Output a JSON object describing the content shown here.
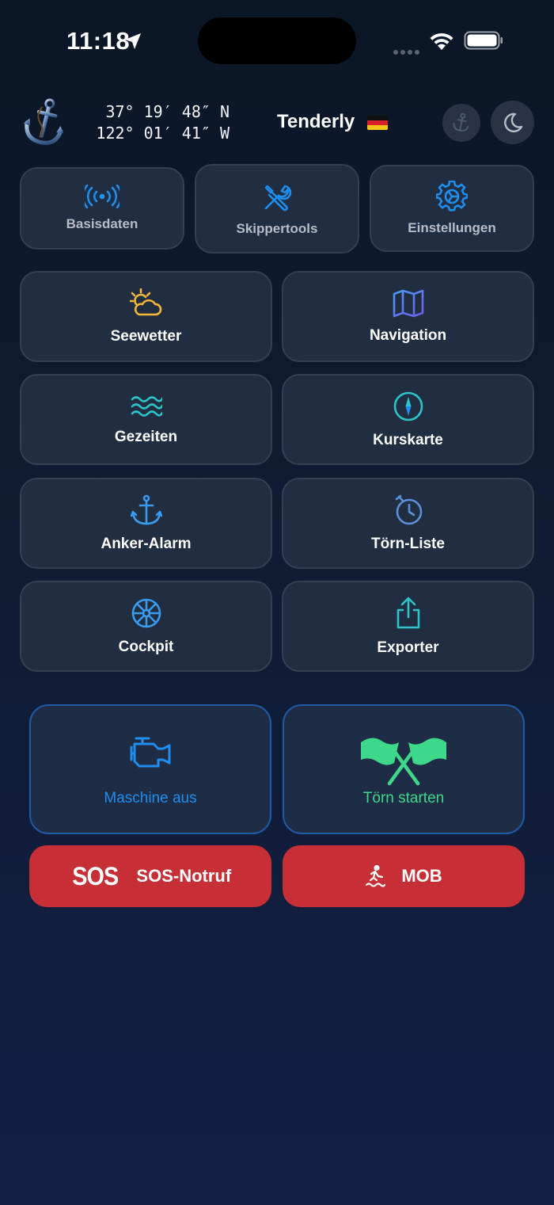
{
  "status_bar": {
    "time": "11:18"
  },
  "header": {
    "latitude": "37° 19′ 48″ N",
    "longitude": "122° 01′ 41″ W",
    "boat_name": "Tenderly"
  },
  "top_tools": [
    {
      "label": "Basisdaten",
      "icon": "antenna-icon"
    },
    {
      "label": "Skippertools",
      "icon": "tools-icon"
    },
    {
      "label": "Einstellungen",
      "icon": "gear-icon"
    }
  ],
  "modules": [
    {
      "label": "Seewetter",
      "icon": "sun-cloud-icon"
    },
    {
      "label": "Navigation",
      "icon": "map-icon"
    },
    {
      "label": "Gezeiten",
      "icon": "waves-icon"
    },
    {
      "label": "Kurskarte",
      "icon": "compass-icon"
    },
    {
      "label": "Anker-Alarm",
      "icon": "anchor-icon"
    },
    {
      "label": "Törn-Liste",
      "icon": "timer-icon"
    },
    {
      "label": "Cockpit",
      "icon": "helm-icon"
    },
    {
      "label": "Exporter",
      "icon": "share-icon"
    }
  ],
  "actions": {
    "engine_label": "Maschine aus",
    "trip_label": "Törn starten"
  },
  "emergency": {
    "sos_mark": "SOS",
    "sos_label": "SOS-Notruf",
    "mob_label": "MOB"
  },
  "colors": {
    "accent_blue": "#1e8ef0",
    "accent_green": "#3ed88a",
    "emergency_red": "#c62f36",
    "tile_bg": "#212d40"
  }
}
